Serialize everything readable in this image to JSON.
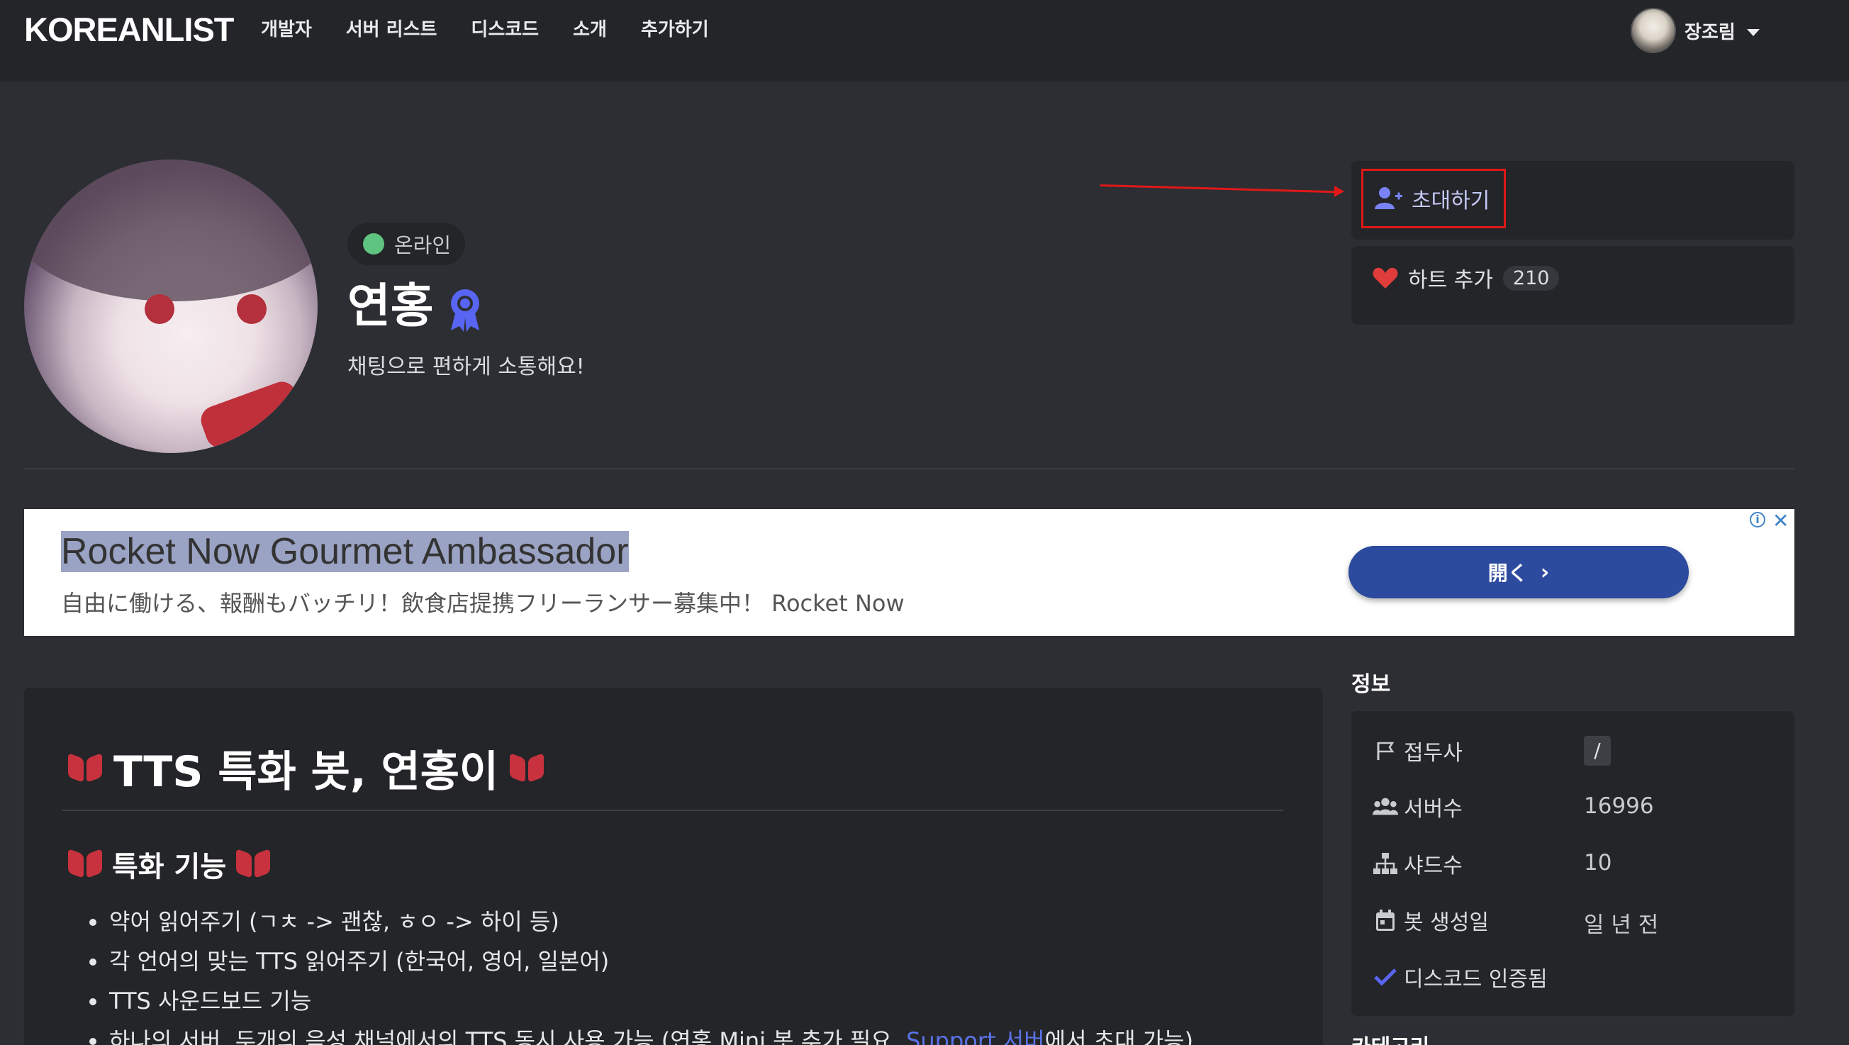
{
  "nav": {
    "logo": "KOREANLIST",
    "links": [
      "개발자",
      "서버 리스트",
      "디스코드",
      "소개",
      "추가하기"
    ],
    "user_name": "장조림"
  },
  "bot": {
    "status": "온라인",
    "name": "연홍",
    "tagline": "채팅으로 편하게 소통해요!"
  },
  "actions": {
    "invite_label": "초대하기",
    "heart_label": "하트 추가",
    "heart_count": "210"
  },
  "ad": {
    "title": "Rocket Now Gourmet Ambassador",
    "subtitle": "自由に働ける、報酬もバッチリ！飲食店提携フリーランサー募集中！ Rocket Now",
    "button_label": "開く",
    "info_icon": "i",
    "close_icon": "✕"
  },
  "description": {
    "heading": "TTS 특화 봇, 연홍이",
    "subheading": "특화 기능",
    "features": [
      "약어 읽어주기 (ㄱㅊ -> 괜찮, ㅎㅇ -> 하이 등)",
      "각 언어의 맞는 TTS 읽어주기 (한국어, 영어, 일본어)",
      "TTS 사운드보드 기능"
    ],
    "feature_partial_prefix": "하나의 서버, 두개의 음성 채널에서의 TTS 동시 사용 가능 (연홍 Mini 봇 추가 필요, ",
    "feature_partial_link": "Support 서버",
    "feature_partial_suffix": "에서 초대 가능)"
  },
  "info": {
    "title": "정보",
    "rows": [
      {
        "label": "접두사",
        "value": "/",
        "icon": "flag-icon"
      },
      {
        "label": "서버수",
        "value": "16996",
        "icon": "users-icon"
      },
      {
        "label": "샤드수",
        "value": "10",
        "icon": "sitemap-icon"
      },
      {
        "label": "봇 생성일",
        "value": "일 년 전",
        "icon": "calendar-icon"
      },
      {
        "label": "디스코드 인증됨",
        "value": "",
        "icon": "check-icon"
      }
    ],
    "category_title": "카테고리"
  },
  "colors": {
    "accent": "#5865f2",
    "online": "#5fc47f",
    "heart": "#e03c3c",
    "annotation": "#e01818"
  }
}
